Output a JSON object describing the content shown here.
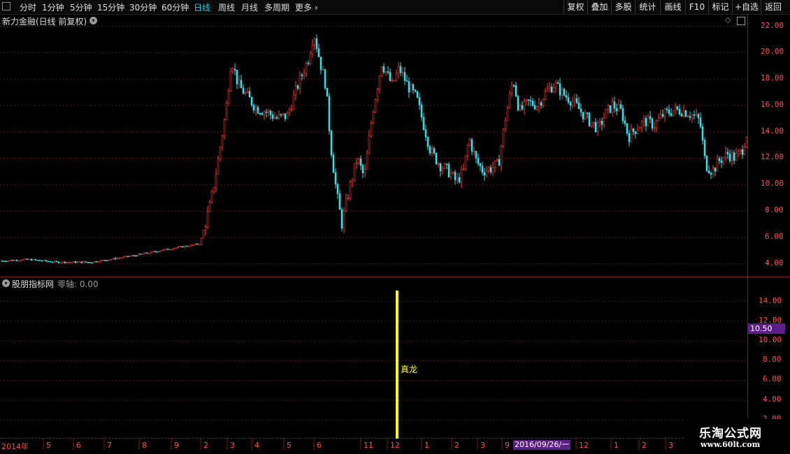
{
  "toolbar": {
    "periods": [
      "分时",
      "1分钟",
      "5分钟",
      "15分钟",
      "30分钟",
      "60分钟",
      "日线",
      "周线",
      "月线",
      "多周期",
      "更多"
    ],
    "active_period": "日线",
    "more_chevron": "›",
    "tools": [
      "复权",
      "叠加",
      "多股",
      "统计",
      "画线",
      "F10",
      "标记",
      "+自选",
      "返回"
    ]
  },
  "main_panel": {
    "title": "新力金融(日线 前复权)",
    "price_axis": [
      "22.00",
      "20.00",
      "18.00",
      "16.00",
      "14.00",
      "12.00",
      "10.00",
      "8.00",
      "6.00",
      "4.00"
    ],
    "colors": {
      "up": "#ff3b3b",
      "down": "#33e0e8",
      "grid": "#5a1414",
      "axis": "#ff4d4d"
    }
  },
  "indicator_panel": {
    "title": "股朋指标网",
    "zero_axis_label": "零轴: 0.00",
    "value_axis": [
      "14.00",
      "12.00",
      "10.00",
      "8.00",
      "6.00",
      "4.00",
      "2.00"
    ],
    "price_tag": "10.50",
    "signal_label": "真龙",
    "signal_color": "#ffff00"
  },
  "date_axis": {
    "labels": [
      "2014年",
      "5",
      "6",
      "7",
      "8",
      "9",
      "2",
      "3",
      "4",
      "5",
      "6",
      "11",
      "12",
      "1",
      "2",
      "3",
      "9",
      "12",
      "1",
      "2",
      "3"
    ],
    "cursor_date": "2016/09/26/一"
  },
  "watermark": {
    "line1": "乐淘公式网",
    "line2": "www.60lt.com"
  }
}
